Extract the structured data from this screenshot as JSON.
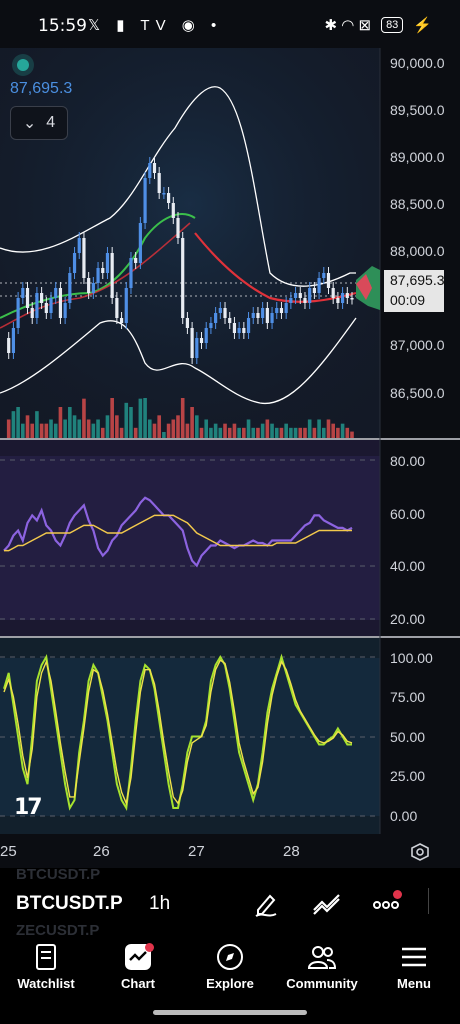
{
  "status_bar": {
    "time": "15:59",
    "left_icons": "𝕏 ▮ TV ◉ •",
    "right_icons": "✱ ◠ ⊠",
    "battery": "83"
  },
  "chart_header": {
    "last_price": "87,695.3",
    "indicator_count": "4"
  },
  "main_axis_labels": [
    "90,000.0",
    "89,500.0",
    "89,000.0",
    "88,500.0",
    "88,000.0",
    "86,500.0",
    "87,000.0"
  ],
  "price_tag": {
    "price": "87,695.3",
    "countdown": "00:09"
  },
  "rsi_axis_labels": [
    "80.00",
    "60.00",
    "40.00",
    "20.00"
  ],
  "stoch_axis_labels": [
    "100.00",
    "75.00",
    "50.00",
    "25.00",
    "0.00"
  ],
  "date_labels": [
    "25",
    "26",
    "27",
    "28"
  ],
  "toolbar": {
    "symbol": "BTCUSDT.P",
    "symbol_above": "BTCUSDT.P",
    "symbol_below": "ZECUSDT.P",
    "interval": "1h"
  },
  "nav": {
    "watchlist": "Watchlist",
    "chart": "Chart",
    "explore": "Explore",
    "community": "Community",
    "menu": "Menu"
  },
  "colors": {
    "up": "#26a69a",
    "down": "#ef5350",
    "candle_up": "#4f8fe6",
    "rsi_line": "#8c63e0",
    "rsi_ma": "#f2c94c",
    "stoch_k": "#a6e22e",
    "stoch_d": "#f0e14a",
    "bollinger": "#ffffff",
    "ema_red": "#e0323a",
    "ema_green": "#3bbf4b"
  },
  "chart_data": {
    "type": "line",
    "price_range": [
      86300,
      90200
    ],
    "price_series": [
      87300,
      87150,
      87400,
      87700,
      87800,
      87600,
      87500,
      87750,
      87650,
      87550,
      87700,
      87800,
      87500,
      87650,
      87950,
      88150,
      88300,
      87900,
      87750,
      87850,
      88000,
      87950,
      88150,
      87700,
      87500,
      87450,
      87800,
      88100,
      88050,
      88450,
      88900,
      89050,
      88950,
      88750,
      88750,
      88650,
      88500,
      88300,
      87500,
      87400,
      87100,
      87300,
      87250,
      87400,
      87450,
      87550,
      87600,
      87500,
      87450,
      87350,
      87400,
      87350,
      87500,
      87550,
      87500,
      87600,
      87450,
      87550,
      87600,
      87550,
      87650,
      87700,
      87750,
      87700,
      87650,
      87800,
      87750,
      87900,
      87950,
      87800,
      87700,
      87650,
      87750,
      87700,
      87695
    ],
    "rsi_range": [
      10,
      88
    ],
    "rsi_series": [
      44,
      46,
      50,
      52,
      48,
      55,
      58,
      56,
      60,
      54,
      52,
      48,
      46,
      50,
      55,
      58,
      60,
      62,
      56,
      52,
      45,
      42,
      44,
      48,
      50,
      54,
      56,
      58,
      60,
      63,
      65,
      64,
      62,
      60,
      58,
      58,
      56,
      54,
      52,
      45,
      40,
      38,
      42,
      44,
      46,
      46,
      48,
      47,
      46,
      45,
      46,
      46,
      47,
      48,
      47,
      47,
      46,
      48,
      48,
      48,
      48,
      48,
      50,
      52,
      54,
      55,
      58,
      58,
      56,
      55,
      54,
      53,
      53,
      52,
      53
    ],
    "rsi_ma_series": [
      44,
      44,
      45,
      46,
      46,
      47,
      48,
      49,
      50,
      51,
      51,
      51,
      51,
      51,
      51,
      52,
      53,
      54,
      54,
      54,
      53,
      52,
      51,
      51,
      51,
      51,
      52,
      53,
      54,
      55,
      56,
      57,
      58,
      58,
      58,
      58,
      58,
      57,
      56,
      55,
      53,
      51,
      50,
      49,
      48,
      47,
      46,
      46,
      46,
      46,
      46,
      46,
      46,
      46,
      46,
      46,
      46,
      46,
      47,
      47,
      47,
      47,
      47,
      48,
      49,
      50,
      51,
      52,
      52,
      52,
      52,
      52,
      52,
      52,
      52
    ],
    "stoch_range": [
      0,
      100
    ],
    "stoch_k_series": [
      80,
      90,
      70,
      50,
      30,
      20,
      50,
      85,
      95,
      100,
      80,
      60,
      40,
      20,
      5,
      10,
      40,
      60,
      85,
      95,
      90,
      75,
      60,
      40,
      20,
      10,
      5,
      30,
      60,
      85,
      95,
      92,
      80,
      60,
      40,
      20,
      5,
      5,
      20,
      40,
      50,
      50,
      50,
      60,
      85,
      95,
      100,
      95,
      80,
      60,
      40,
      30,
      20,
      10,
      20,
      40,
      65,
      80,
      90,
      100,
      90,
      80,
      70,
      65,
      60,
      55,
      50,
      45,
      45,
      48,
      50,
      55,
      50,
      45,
      45
    ],
    "stoch_d_series": [
      78,
      86,
      75,
      58,
      38,
      24,
      42,
      75,
      90,
      97,
      85,
      66,
      46,
      28,
      12,
      12,
      34,
      55,
      78,
      92,
      90,
      79,
      64,
      46,
      28,
      15,
      8,
      24,
      52,
      78,
      92,
      92,
      83,
      66,
      46,
      28,
      12,
      8,
      16,
      34,
      46,
      48,
      50,
      57,
      78,
      92,
      98,
      96,
      84,
      66,
      46,
      34,
      24,
      14,
      18,
      34,
      58,
      76,
      88,
      97,
      92,
      83,
      73,
      66,
      61,
      56,
      51,
      47,
      46,
      47,
      49,
      53,
      51,
      47,
      46
    ],
    "x_tick_labels": [
      "25",
      "26",
      "27",
      "28"
    ]
  }
}
